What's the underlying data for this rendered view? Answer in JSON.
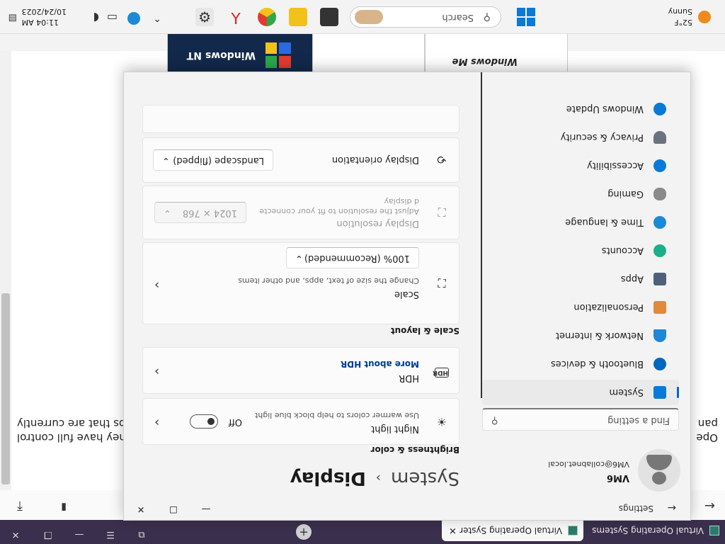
{
  "browser": {
    "tabs": [
      {
        "label": "Virtual Operating Systems",
        "active": false
      },
      {
        "label": "Virtual Operating Syster",
        "active": true
      }
    ],
    "new_tab": "+",
    "address": "Settings"
  },
  "page": {
    "text_line1": "Ope",
    "text_line1_right": "hey have full control",
    "text_line2": "pan",
    "text_line2_right": "ps that are currently"
  },
  "settings": {
    "title": "Settings",
    "profile": {
      "name": "VM6",
      "email": "VM6@collabnet.local"
    },
    "search_placeholder": "Find a setting",
    "breadcrumb": {
      "parent": "System",
      "separator": "›",
      "current": "Display"
    },
    "nav": [
      {
        "label": "System",
        "selected": true,
        "color": "#0a7ad6"
      },
      {
        "label": "Bluetooth & devices",
        "color": "#0067c0"
      },
      {
        "label": "Network & internet",
        "color": "#1f87d8"
      },
      {
        "label": "Personalization",
        "color": "#e08a3a"
      },
      {
        "label": "Apps",
        "color": "#50607a"
      },
      {
        "label": "Accounts",
        "color": "#1fae8a"
      },
      {
        "label": "Time & language",
        "color": "#1b8ad6"
      },
      {
        "label": "Gaming",
        "color": "#8a8a8a"
      },
      {
        "label": "Accessibility",
        "color": "#0a7ad6"
      },
      {
        "label": "Privacy & security",
        "color": "#6b7280"
      },
      {
        "label": "Windows Update",
        "color": "#0a7ad6"
      }
    ],
    "sections": {
      "brightness": "Brightness & color",
      "scale": "Scale & layout"
    },
    "night_light": {
      "title": "Night light",
      "sub": "Use warmer colors to help block blue light",
      "state": "Off"
    },
    "hdr": {
      "title": "HDR",
      "link": "More about HDR"
    },
    "scale": {
      "title": "Scale",
      "sub": "Change the size of text, apps, and other items",
      "value": "100% (Recommended)"
    },
    "resolution": {
      "title": "Display resolution",
      "sub1": "Adjust the resolution to fit your connecte",
      "sub2": "d display",
      "value": "1024 × 768"
    },
    "orientation": {
      "title": "Display orientation",
      "value": "Landscape (flipped)"
    }
  },
  "os_thumbs": {
    "me": "Windows Me",
    "nt": "Windows NT"
  },
  "taskbar": {
    "weather_temp": "52°F",
    "weather_desc": "Sunny",
    "search_placeholder": "Search",
    "time": "11:04 AM",
    "date": "10/24/2023"
  }
}
